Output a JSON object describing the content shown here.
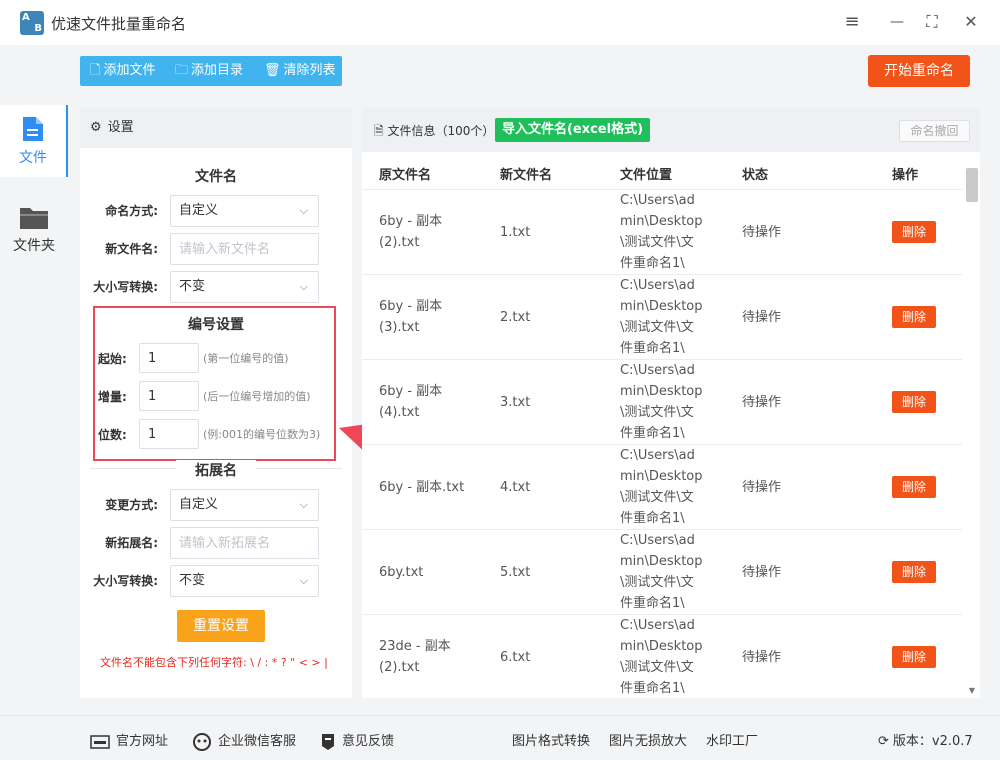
{
  "app": {
    "logo_text_a": "A",
    "logo_text_b": "B",
    "title": "优速文件批量重命名"
  },
  "window_controls": {
    "menu": "≡",
    "minimize": "—",
    "maximize": "⛶",
    "close": "✕"
  },
  "sidebar": {
    "items": [
      {
        "label": "文件",
        "icon": "file-icon",
        "active": true
      },
      {
        "label": "文件夹",
        "icon": "folder-icon",
        "active": false
      }
    ]
  },
  "toolbar": {
    "add_file": "添加文件",
    "add_dir": "添加目录",
    "clear_list": "清除列表",
    "start": "开始重命名"
  },
  "settings": {
    "header": "设置",
    "filename_section": "文件名",
    "naming_mode_label": "命名方式:",
    "naming_mode_value": "自定义",
    "new_name_label": "新文件名:",
    "new_name_placeholder": "请输入新文件名",
    "case_label": "大小写转换:",
    "case_value": "不变",
    "numbering_section": "编号设置",
    "start_label": "起始:",
    "start_value": "1",
    "start_hint": "(第一位编号的值)",
    "increment_label": "增量:",
    "increment_value": "1",
    "increment_hint": "(后一位编号增加的值)",
    "digits_label": "位数:",
    "digits_value": "1",
    "digits_hint": "(例:001的编号位数为3)",
    "ext_section": "拓展名",
    "ext_mode_label": "变更方式:",
    "ext_mode_value": "自定义",
    "new_ext_label": "新拓展名:",
    "new_ext_placeholder": "请输入新拓展名",
    "ext_case_label": "大小写转换:",
    "ext_case_value": "不变",
    "reset": "重置设置",
    "warning": "文件名不能包含下列任何字符: \\ / : * ? \" < > |"
  },
  "file_panel": {
    "title": "文件信息（100个）",
    "import_btn": "导入文件名(excel格式)",
    "undo_btn": "命名撤回",
    "columns": [
      "原文件名",
      "新文件名",
      "文件位置",
      "状态",
      "操作"
    ],
    "rows": [
      {
        "orig": "6by - 副本 (2).txt",
        "new": "1.txt",
        "loc": "C:\\Users\\admin\\Desktop\\测试文件\\文件重命名1\\",
        "status": "待操作",
        "action": "删除"
      },
      {
        "orig": "6by - 副本 (3).txt",
        "new": "2.txt",
        "loc": "C:\\Users\\admin\\Desktop\\测试文件\\文件重命名1\\",
        "status": "待操作",
        "action": "删除"
      },
      {
        "orig": "6by - 副本 (4).txt",
        "new": "3.txt",
        "loc": "C:\\Users\\admin\\Desktop\\测试文件\\文件重命名1\\",
        "status": "待操作",
        "action": "删除"
      },
      {
        "orig": "6by - 副本.txt",
        "new": "4.txt",
        "loc": "C:\\Users\\admin\\Desktop\\测试文件\\文件重命名1\\",
        "status": "待操作",
        "action": "删除"
      },
      {
        "orig": "6by.txt",
        "new": "5.txt",
        "loc": "C:\\Users\\admin\\Desktop\\测试文件\\文件重命名1\\",
        "status": "待操作",
        "action": "删除"
      },
      {
        "orig": "23de - 副本 (2).txt",
        "new": "6.txt",
        "loc": "C:\\Users\\admin\\Desktop\\测试文件\\文件重命名1\\",
        "status": "待操作",
        "action": "删除"
      }
    ]
  },
  "footer": {
    "website": "官方网址",
    "wechat": "企业微信客服",
    "feedback": "意见反馈",
    "img_convert": "图片格式转换",
    "img_enlarge": "图片无损放大",
    "watermark": "水印工厂",
    "version": "版本：v2.0.7"
  },
  "colors": {
    "accent_blue": "#41b4f0",
    "primary_orange": "#f25319",
    "import_green": "#1fbf5c",
    "reset_yellow": "#f9a31a",
    "highlight_red": "#f0465a"
  }
}
